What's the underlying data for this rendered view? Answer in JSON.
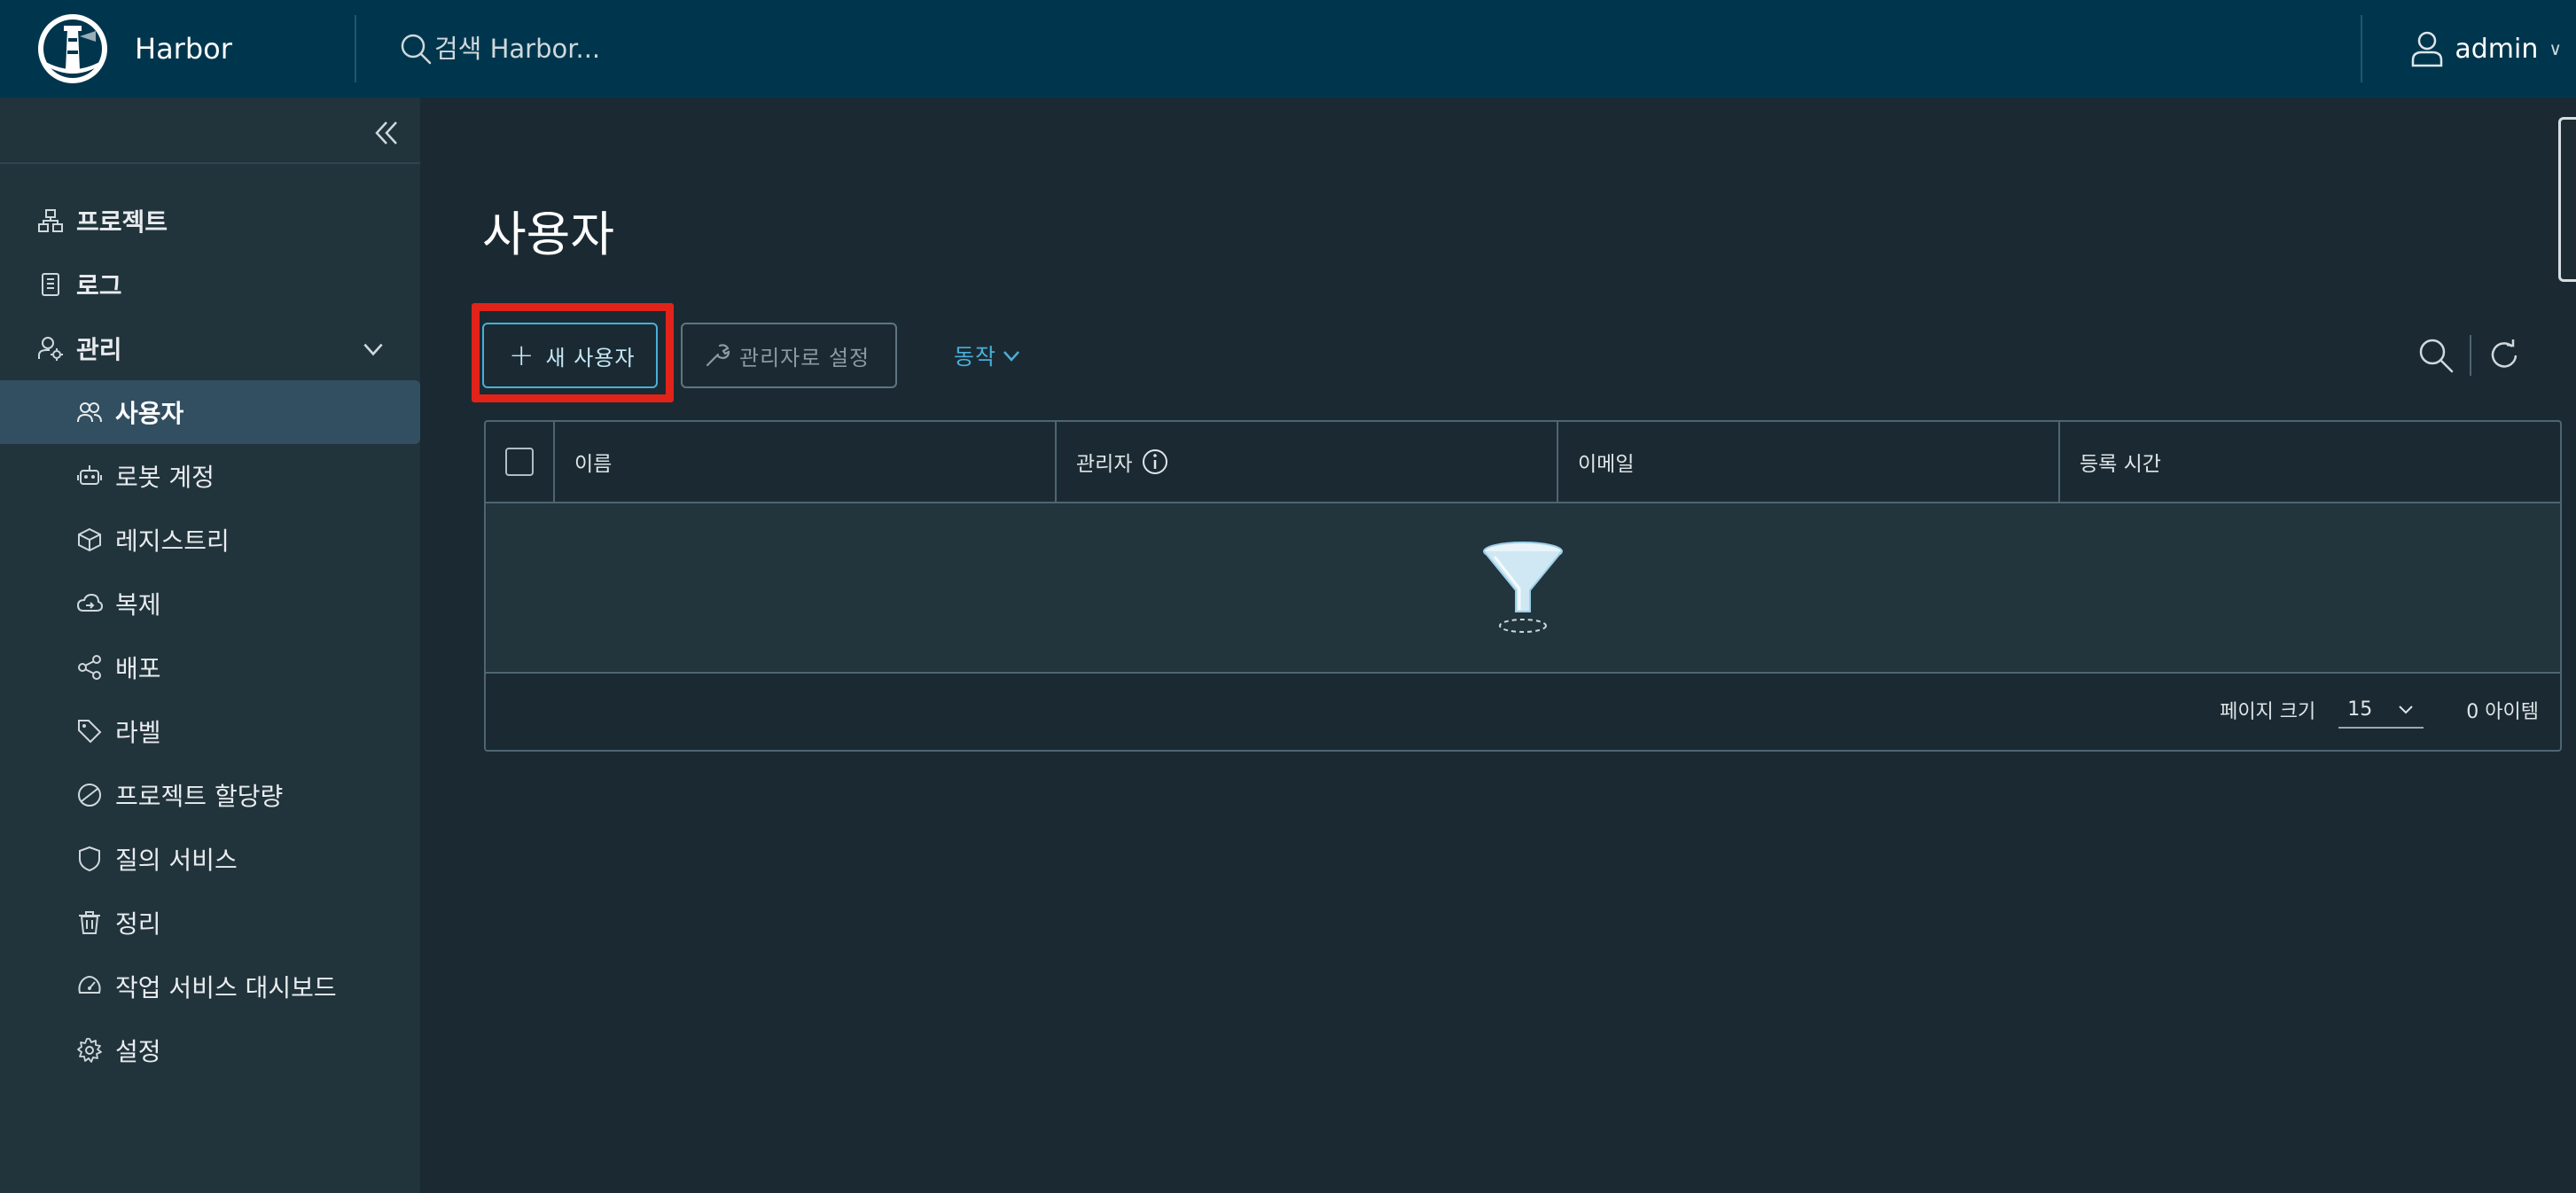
{
  "header": {
    "brand": "Harbor",
    "search_placeholder": "검색 Harbor...",
    "user": "admin"
  },
  "sidebar": {
    "items": [
      {
        "label": "프로젝트",
        "icon": "projects-icon"
      },
      {
        "label": "로그",
        "icon": "logs-icon"
      },
      {
        "label": "관리",
        "icon": "admin-icon"
      },
      {
        "label": "사용자",
        "icon": "users-icon"
      },
      {
        "label": "로봇 계정",
        "icon": "robot-icon"
      },
      {
        "label": "레지스트리",
        "icon": "registry-icon"
      },
      {
        "label": "복제",
        "icon": "replication-icon"
      },
      {
        "label": "배포",
        "icon": "distribution-icon"
      },
      {
        "label": "라벨",
        "icon": "label-icon"
      },
      {
        "label": "프로젝트 할당량",
        "icon": "quota-icon"
      },
      {
        "label": "질의 서비스",
        "icon": "interrogation-icon"
      },
      {
        "label": "정리",
        "icon": "cleanup-icon"
      },
      {
        "label": "작업 서비스 대시보드",
        "icon": "dashboard-icon"
      },
      {
        "label": "설정",
        "icon": "settings-icon"
      }
    ],
    "active": "사용자"
  },
  "main": {
    "title": "사용자",
    "buttons": {
      "new_user": "새 사용자",
      "set_admin": "관리자로 설정",
      "action": "동작"
    },
    "table": {
      "columns": [
        "이름",
        "관리자",
        "이메일",
        "등록 시간"
      ],
      "rows": []
    },
    "footer": {
      "page_size_label": "페이지 크기",
      "page_size": "15",
      "total": "0 아이템"
    }
  },
  "colors": {
    "header_bg": "#00364d",
    "accent": "#49afd9",
    "highlight": "#e2231a"
  }
}
